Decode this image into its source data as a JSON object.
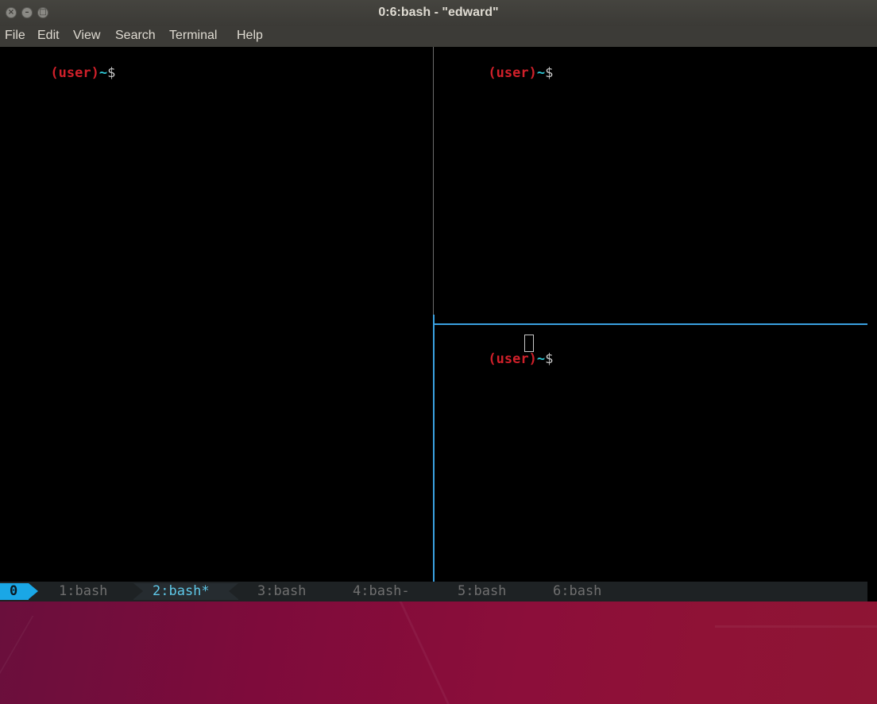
{
  "window": {
    "title": "0:6:bash - \"edward\"",
    "controls": [
      "close-icon",
      "minimize-icon",
      "maximize-icon"
    ]
  },
  "menubar": {
    "items": [
      "File",
      "Edit",
      "View",
      "Search",
      "Terminal",
      "Help"
    ]
  },
  "prompt": {
    "user": "(user)",
    "tilde": "~",
    "dollar": "$"
  },
  "tmux": {
    "session": "0",
    "windows": [
      {
        "label": "1:bash",
        "active": false
      },
      {
        "label": "2:bash*",
        "active": true
      },
      {
        "label": "3:bash",
        "active": false
      },
      {
        "label": "4:bash-",
        "active": false
      },
      {
        "label": "5:bash",
        "active": false
      },
      {
        "label": "6:bash",
        "active": false
      }
    ]
  },
  "colors": {
    "prompt_user": "#d0202a",
    "prompt_tilde": "#2ec5d3",
    "active_pane_border": "#3aa0e0",
    "session_badge": "#1aa7e6",
    "active_window_text": "#5fc8e8"
  }
}
